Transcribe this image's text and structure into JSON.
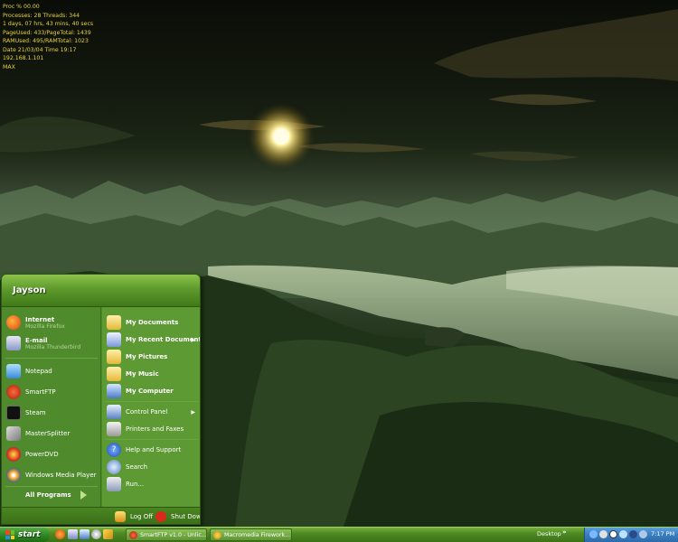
{
  "sysinfo": {
    "lines": [
      "Proc % 00.00",
      "Processes: 28   Threads: 344",
      "1 days, 07 hrs, 43 mins, 40 secs",
      "PageUsed: 433/PageTotal: 1439",
      "RAMUsed: 495/RAMTotal: 1023",
      "Date 21/03/04 Time 19:17",
      "192.168.1.101",
      "MAX"
    ]
  },
  "start_menu": {
    "user": "Jayson",
    "pinned": [
      {
        "label": "Internet",
        "sub": "Mozilla Firefox",
        "icon": "firefox-icon"
      },
      {
        "label": "E-mail",
        "sub": "Mozilla Thunderbird",
        "icon": "mail-icon"
      }
    ],
    "recent": [
      {
        "label": "Notepad",
        "icon": "notepad-icon"
      },
      {
        "label": "SmartFTP",
        "icon": "smartftp-icon"
      },
      {
        "label": "Steam",
        "icon": "steam-icon"
      },
      {
        "label": "MasterSplitter",
        "icon": "hammer-icon"
      },
      {
        "label": "PowerDVD",
        "icon": "dvd-icon"
      },
      {
        "label": "Windows Media Player",
        "icon": "media-player-icon"
      }
    ],
    "all_programs": "All Programs",
    "right": {
      "my_documents": "My Documents",
      "my_recent_documents": "My Recent Documents",
      "my_pictures": "My Pictures",
      "my_music": "My Music",
      "my_computer": "My Computer",
      "control_panel": "Control Panel",
      "printers": "Printers and Faxes",
      "help": "Help and Support",
      "search": "Search",
      "run": "Run..."
    },
    "footer": {
      "log_off": "Log Off",
      "shut_down": "Shut Down"
    }
  },
  "taskbar": {
    "start_label": "start",
    "buttons": [
      {
        "label": "SmartFTP v1.0 - Unlic..."
      },
      {
        "label": "Macromedia Firework..."
      }
    ],
    "desktop_label": "Desktop",
    "chevron": "»",
    "clock": "7:17 PM"
  },
  "colors": {
    "start_menu_bg": "#4e8a2a",
    "taskbar": "#4e8a22",
    "tray": "#3a7ec0",
    "sysinfo_text": "#e8d23a"
  }
}
